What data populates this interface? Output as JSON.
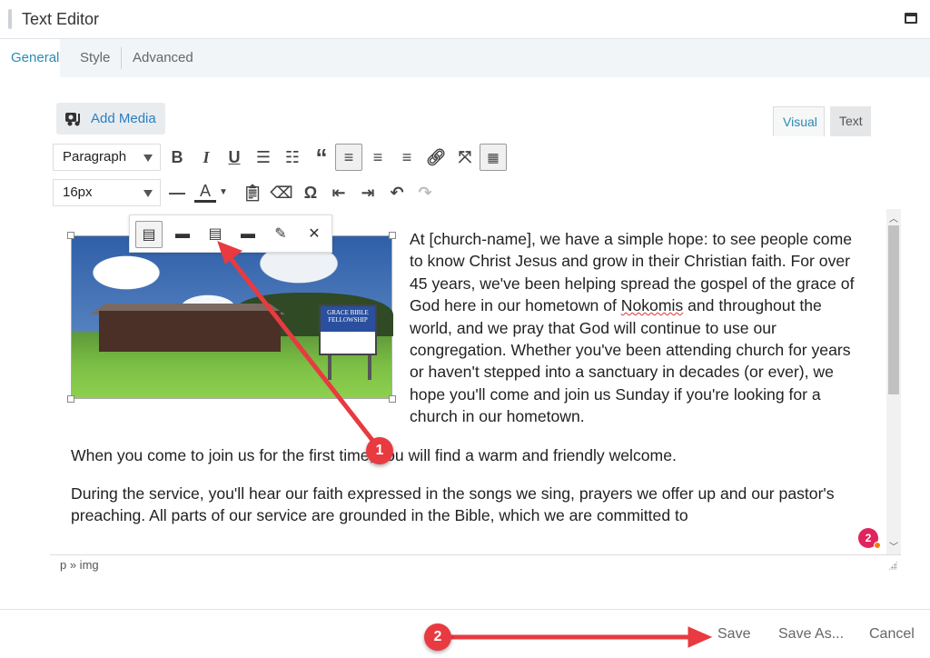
{
  "window": {
    "title": "Text Editor",
    "maximize_icon": "window-maximize-icon"
  },
  "tabs": [
    {
      "label": "General",
      "active": true
    },
    {
      "label": "Style"
    },
    {
      "label": "Advanced"
    }
  ],
  "editor": {
    "add_media": "Add Media",
    "mode_tabs": {
      "visual": "Visual",
      "text": "Text",
      "active": "Visual"
    },
    "format_select": "Paragraph",
    "font_size_select": "16px",
    "toolbar_row1": [
      "bold",
      "italic",
      "underline",
      "bulleted-list",
      "numbered-list",
      "blockquote",
      "align-left",
      "align-center",
      "align-right",
      "link",
      "fullscreen",
      "toolbar-toggle"
    ],
    "toolbar_row2": [
      "horizontal-line",
      "text-color",
      "paste-as-text",
      "clear-formatting",
      "special-character",
      "outdent",
      "indent",
      "undo",
      "redo"
    ],
    "image_toolbar": [
      "align-left",
      "align-center",
      "align-right",
      "no-alignment",
      "edit",
      "remove"
    ],
    "paragraphs": [
      {
        "before": "At [church-name], we have a simple hope: to see people come to know Christ Jesus and grow in their Christian faith. For over 45 years, we've been helping spread the gospel of the grace of God here in our hometown of ",
        "misspelled": "Nokomis",
        "after": " and throughout the world, and we pray that God will continue to use our congregation. Whether you've been attending church for years or haven't stepped into a sanctuary in decades (or ever), we hope you'll come and join us Sunday if you're looking for a church in our hometown."
      },
      {
        "text": "When you come to join us for the first time, you will find a warm and friendly welcome."
      },
      {
        "text": "During the service, you'll hear our faith expressed in the songs we sing, prayers we offer up and our pastor's preaching. All parts of our service are grounded in the Bible, which we are committed to"
      }
    ],
    "image_sign_text": "GRACE BIBLE FELLOWSHIP",
    "status_path": "p » img",
    "notification_badge": "2"
  },
  "footer": {
    "save": "Save",
    "save_as": "Save As...",
    "cancel": "Cancel"
  },
  "annotations": [
    {
      "label": "1"
    },
    {
      "label": "2"
    }
  ],
  "colors": {
    "accent": "#2a8bb5",
    "annotation": "#e83a40",
    "badge": "#e0245e"
  }
}
